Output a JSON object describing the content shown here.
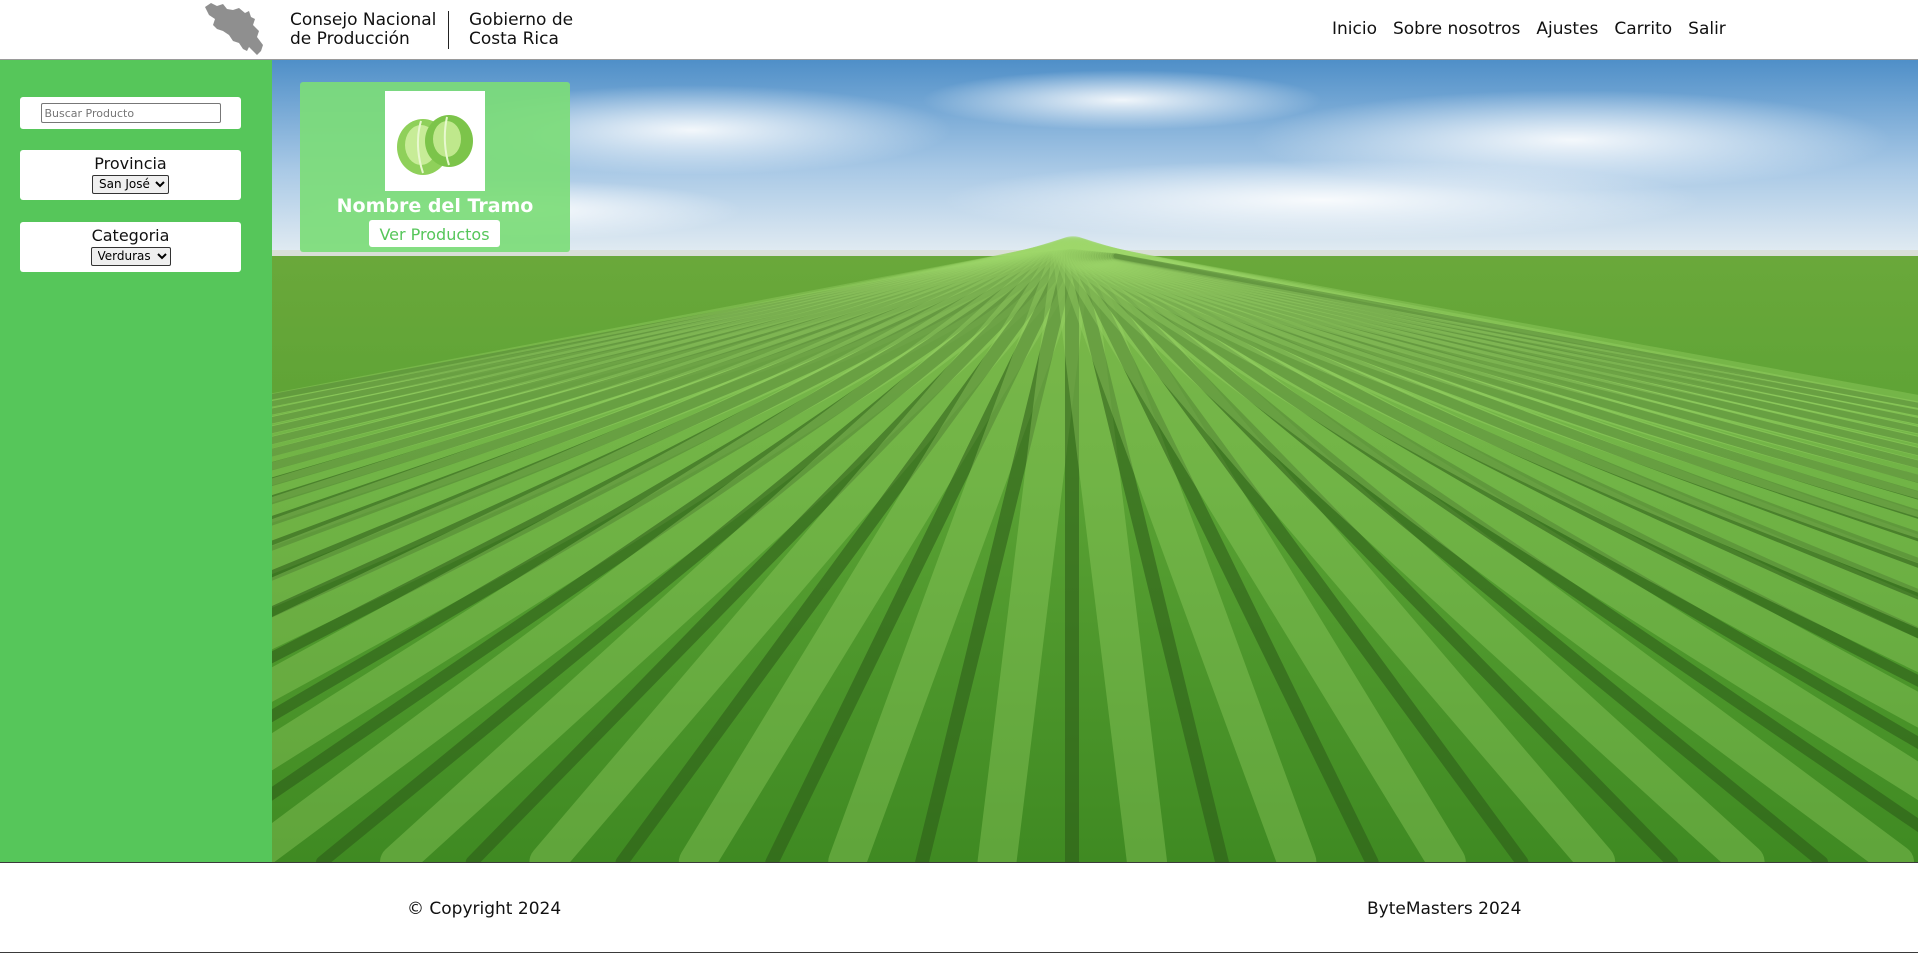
{
  "header": {
    "org_name_line1": "Consejo Nacional",
    "org_name_line2": "de Producción",
    "gov_name_line1": "Gobierno de",
    "gov_name_line2": "Costa Rica",
    "nav": {
      "home": "Inicio",
      "about": "Sobre nosotros",
      "settings": "Ajustes",
      "cart": "Carrito",
      "logout": "Salir"
    }
  },
  "sidebar": {
    "search_placeholder": "Buscar Producto",
    "province": {
      "title": "Provincia",
      "selected": "San José"
    },
    "category": {
      "title": "Categoria",
      "selected": "Verduras"
    }
  },
  "card": {
    "title": "Nombre del Tramo",
    "button": "Ver Productos"
  },
  "footer": {
    "copyright": "© Copyright 2024",
    "credits": "ByteMasters 2024"
  },
  "colors": {
    "brand_green": "#56c65a",
    "card_green": "#7cdc78",
    "white": "#ffffff"
  }
}
